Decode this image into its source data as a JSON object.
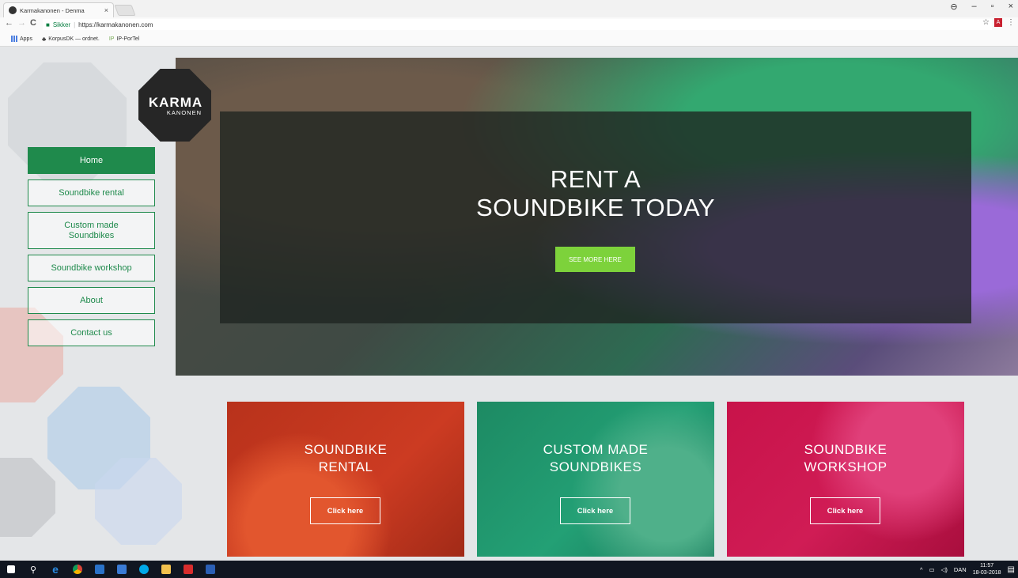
{
  "browser": {
    "tab_title": "Karmakanonen - Denma",
    "tab_close": "×",
    "window_controls": [
      "⊖",
      "–",
      "▫",
      "×"
    ],
    "back": "←",
    "forward": "→",
    "reload": "C",
    "secure_label": "Sikker",
    "url": "https://karmakanonen.com",
    "star": "☆",
    "pdf": "A",
    "menu": "⋮",
    "bookmarks": [
      "Apps",
      "KorpusDK — ordnet.",
      "IP-PorTel"
    ],
    "bookmark_ip_prefix": "IP"
  },
  "logo": {
    "line1": "KARMA",
    "line2": "KANONEN"
  },
  "menu": {
    "items": [
      {
        "label": "Home",
        "active": true
      },
      {
        "label": "Soundbike rental",
        "active": false
      },
      {
        "label": "Custom made Soundbikes",
        "active": false
      },
      {
        "label": "Soundbike workshop",
        "active": false
      },
      {
        "label": "About",
        "active": false
      },
      {
        "label": "Contact us",
        "active": false
      }
    ]
  },
  "hero": {
    "title_line1": "RENT A",
    "title_line2": "SOUNDBIKE TODAY",
    "button": "SEE MORE HERE"
  },
  "cards": [
    {
      "line1": "SOUNDBIKE",
      "line2": "RENTAL",
      "button": "Click here",
      "color": "#c8321e"
    },
    {
      "line1": "CUSTOM MADE",
      "line2": "SOUNDBIKES",
      "button": "Click here",
      "color": "#1f9a6e"
    },
    {
      "line1": "SOUNDBIKE",
      "line2": "WORKSHOP",
      "button": "Click here",
      "color": "#c8134a"
    }
  ],
  "taskbar": {
    "tray_lang": "DAN",
    "time": "11:57",
    "date": "18-03-2018"
  },
  "colors": {
    "brand_green": "#1f8a4c",
    "hero_button": "#7dd23b"
  }
}
